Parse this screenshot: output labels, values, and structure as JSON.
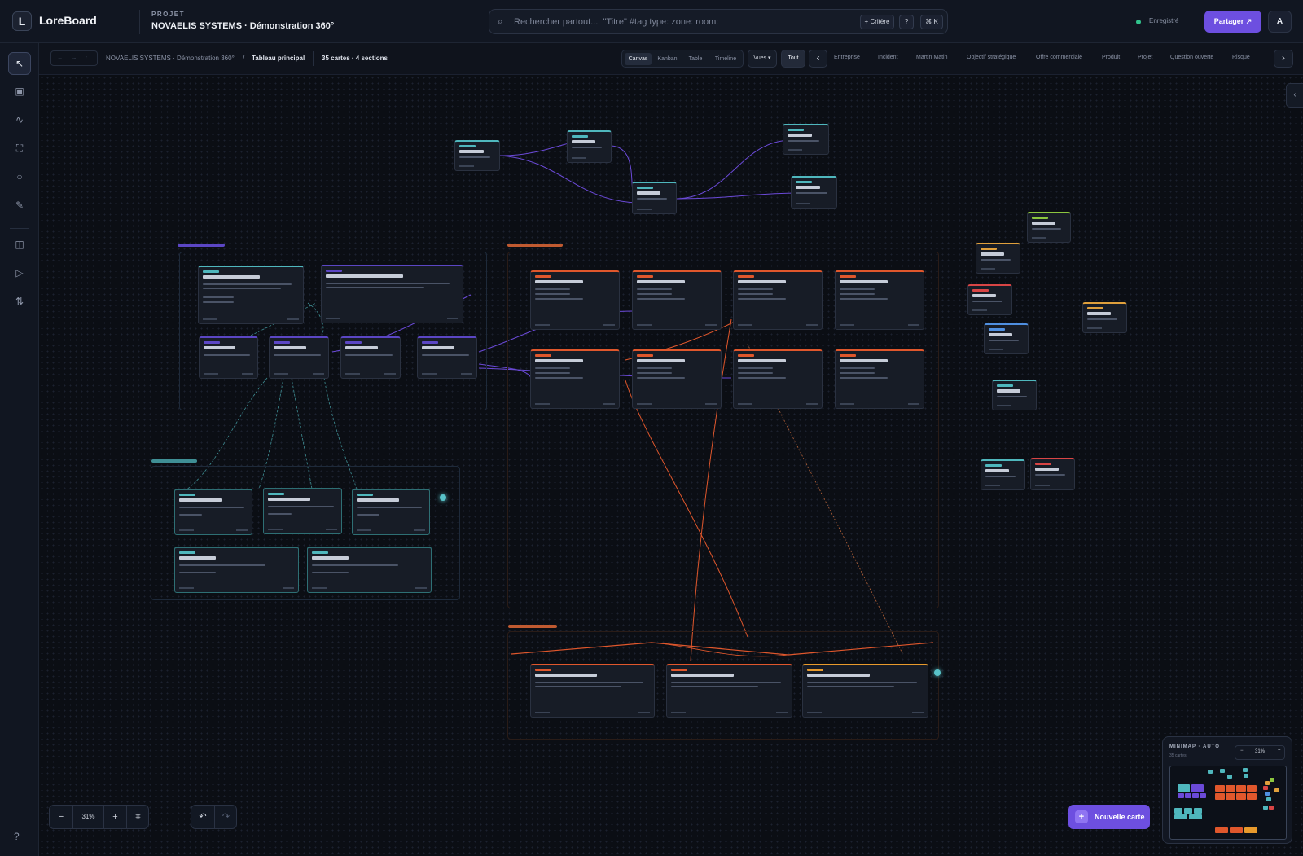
{
  "app": {
    "logo_letter": "L",
    "name": "LoreBoard"
  },
  "project": {
    "kicker": "PROJET",
    "title": "NOVAELIS SYSTEMS · Démonstration 360°"
  },
  "search": {
    "placeholder": "Rechercher partout...  \"Titre\" #tag type: zone: room:",
    "chip_criteria": "+ Critère",
    "chip_help": "?",
    "chip_shortcut": "⌘ K"
  },
  "status": {
    "saved": "Enregistré"
  },
  "actions": {
    "share": "Partager ↗",
    "avatar": "A"
  },
  "breadcrumb": {
    "nav": "← → ↑",
    "project": "NOVAELIS SYSTEMS · Démonstration 360°",
    "separator": "/",
    "board": "Tableau principal",
    "count": "35 cartes · 4 sections"
  },
  "views": {
    "tabs": [
      "Canvas",
      "Kanban",
      "Table",
      "Timeline"
    ],
    "active": "Canvas",
    "vues_label": "Vues ▾",
    "all_label": "Tout"
  },
  "filters": [
    "Entreprise",
    "Incident",
    "Martin Matin",
    "Objectif stratégique",
    "Offre commerciale",
    "Produit",
    "Projet",
    "Question ouverte",
    "Risque"
  ],
  "tools": [
    "cursor-icon",
    "card-icon",
    "link-curve-icon",
    "frame-icon",
    "circle-icon",
    "pen-icon",
    "panel-icon",
    "play-icon",
    "sort-icon"
  ],
  "zoom": {
    "minus": "−",
    "value": "31%",
    "plus": "+",
    "fit": "⌗"
  },
  "history": {
    "undo": "↶",
    "redo": "↷"
  },
  "help": "?",
  "new_card": {
    "plus": "+",
    "label": "Nouvelle carte"
  },
  "minimap": {
    "title": "MINIMAP · AUTO",
    "subtitle": "35 cartes",
    "minus": "−",
    "value": "31%",
    "plus": "+"
  },
  "colors": {
    "accent": "#6d4fe0",
    "teal": "#4fb7bd",
    "orange": "#e0572c",
    "purple": "#6b4ad8",
    "saved": "#31c48d",
    "canvas": "#0b0e14"
  }
}
